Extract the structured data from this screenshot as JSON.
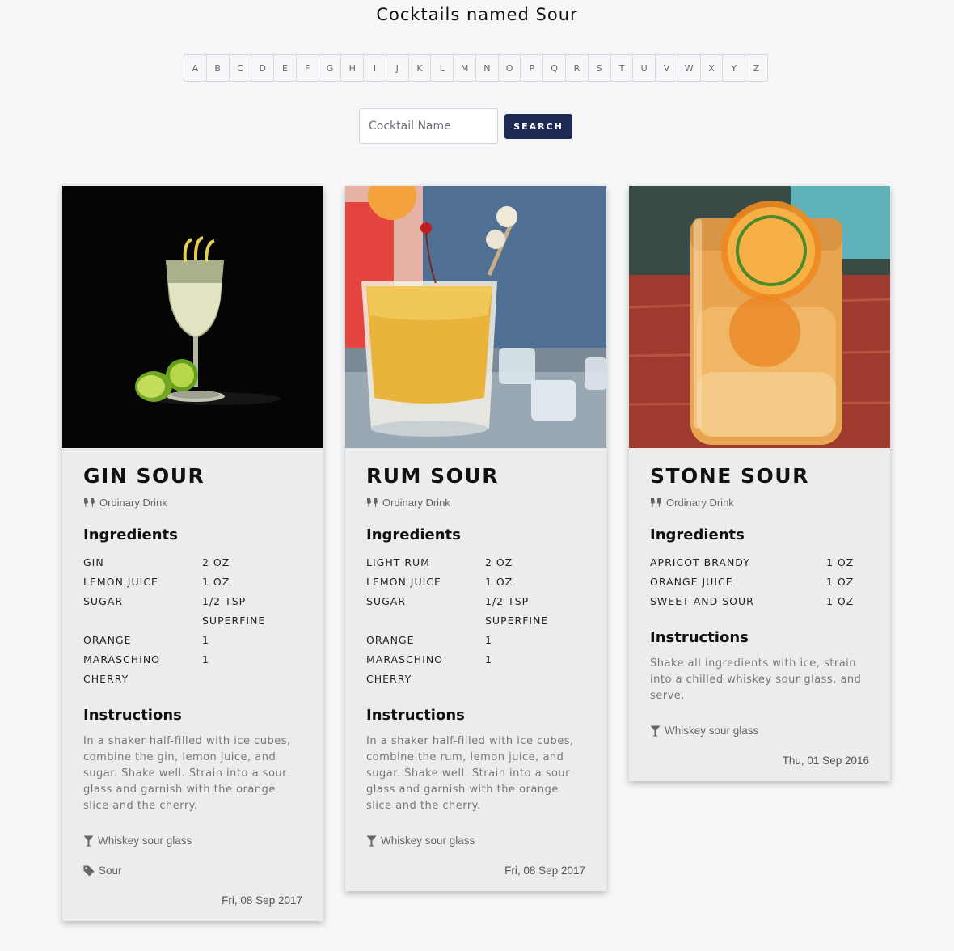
{
  "header": {
    "title": "Cocktails named Sour"
  },
  "alphabet": [
    "A",
    "B",
    "C",
    "D",
    "E",
    "F",
    "G",
    "H",
    "I",
    "J",
    "K",
    "L",
    "M",
    "N",
    "O",
    "P",
    "Q",
    "R",
    "S",
    "T",
    "U",
    "V",
    "W",
    "X",
    "Y",
    "Z"
  ],
  "search": {
    "placeholder": "Cocktail Name",
    "button_label": "SEARCH"
  },
  "cards": [
    {
      "title": "GIN SOUR",
      "category": "Ordinary Drink",
      "ingredients_heading": "Ingredients",
      "ingredients": [
        {
          "name": "GIN",
          "measure": "2 OZ"
        },
        {
          "name": "LEMON JUICE",
          "measure": "1 OZ"
        },
        {
          "name": "SUGAR",
          "measure": "1/2 TSP SUPERFINE"
        },
        {
          "name": "ORANGE",
          "measure": "1"
        },
        {
          "name": "MARASCHINO CHERRY",
          "measure": "1"
        }
      ],
      "instructions_heading": "Instructions",
      "instructions": "In a shaker half-filled with ice cubes, combine the gin, lemon juice, and sugar. Shake well. Strain into a sour glass and garnish with the orange slice and the cherry.",
      "glass": "Whiskey sour glass",
      "tag": "Sour",
      "date": "Fri, 08 Sep 2017"
    },
    {
      "title": "RUM SOUR",
      "category": "Ordinary Drink",
      "ingredients_heading": "Ingredients",
      "ingredients": [
        {
          "name": "LIGHT RUM",
          "measure": "2 OZ"
        },
        {
          "name": "LEMON JUICE",
          "measure": "1 OZ"
        },
        {
          "name": "SUGAR",
          "measure": "1/2 TSP SUPERFINE"
        },
        {
          "name": "ORANGE",
          "measure": "1"
        },
        {
          "name": "MARASCHINO CHERRY",
          "measure": "1"
        }
      ],
      "instructions_heading": "Instructions",
      "instructions": "In a shaker half-filled with ice cubes, combine the rum, lemon juice, and sugar. Shake well. Strain into a sour glass and garnish with the orange slice and the cherry.",
      "glass": "Whiskey sour glass",
      "date": "Fri, 08 Sep 2017"
    },
    {
      "title": "STONE SOUR",
      "category": "Ordinary Drink",
      "ingredients_heading": "Ingredients",
      "ingredients": [
        {
          "name": "APRICOT BRANDY",
          "measure": "1 OZ"
        },
        {
          "name": "ORANGE JUICE",
          "measure": "1 OZ"
        },
        {
          "name": "SWEET AND SOUR",
          "measure": "1 OZ"
        }
      ],
      "instructions_heading": "Instructions",
      "instructions": "Shake all ingredients with ice, strain into a chilled whiskey sour glass, and serve.",
      "glass": "Whiskey sour glass",
      "date": "Thu, 01 Sep 2016"
    }
  ]
}
